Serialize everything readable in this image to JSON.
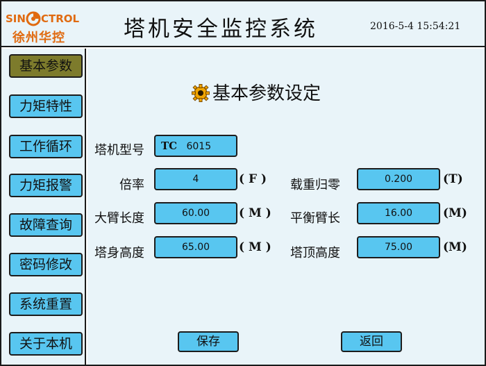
{
  "header": {
    "logo_top_left": "SIN",
    "logo_top_right": "CTROL",
    "logo_bottom": "徐州华控",
    "title": "塔机安全监控系统",
    "datetime": "2016-5-4  15:54:21"
  },
  "sidebar": {
    "items": [
      {
        "label": "基本参数",
        "active": true
      },
      {
        "label": "力矩特性",
        "active": false
      },
      {
        "label": "工作循环",
        "active": false
      },
      {
        "label": "力矩报警",
        "active": false
      },
      {
        "label": "故障查询",
        "active": false
      },
      {
        "label": "密码修改",
        "active": false
      },
      {
        "label": "系统重置",
        "active": false
      },
      {
        "label": "关于本机",
        "active": false
      }
    ]
  },
  "main": {
    "title": "基本参数设定",
    "model": {
      "label": "塔机型号",
      "prefix": "TC",
      "value": "6015"
    },
    "left_fields": [
      {
        "label": "倍率",
        "value": "4",
        "unit": "( F )"
      },
      {
        "label": "大臂长度",
        "value": "60.00",
        "unit": "( M )"
      },
      {
        "label": "塔身高度",
        "value": "65.00",
        "unit": "( M )"
      }
    ],
    "right_fields": [
      {
        "label": "载重归零",
        "value": "0.200",
        "unit": "(T)"
      },
      {
        "label": "平衡臂长",
        "value": "16.00",
        "unit": "(M)"
      },
      {
        "label": "塔顶高度",
        "value": "75.00",
        "unit": "(M)"
      }
    ],
    "save_label": "保存",
    "back_label": "返回"
  },
  "colors": {
    "background": "#e9f4f9",
    "button": "#58c6f0",
    "active_button": "#7d7b2c",
    "logo": "#e06a10",
    "gear": "#f0a500"
  }
}
